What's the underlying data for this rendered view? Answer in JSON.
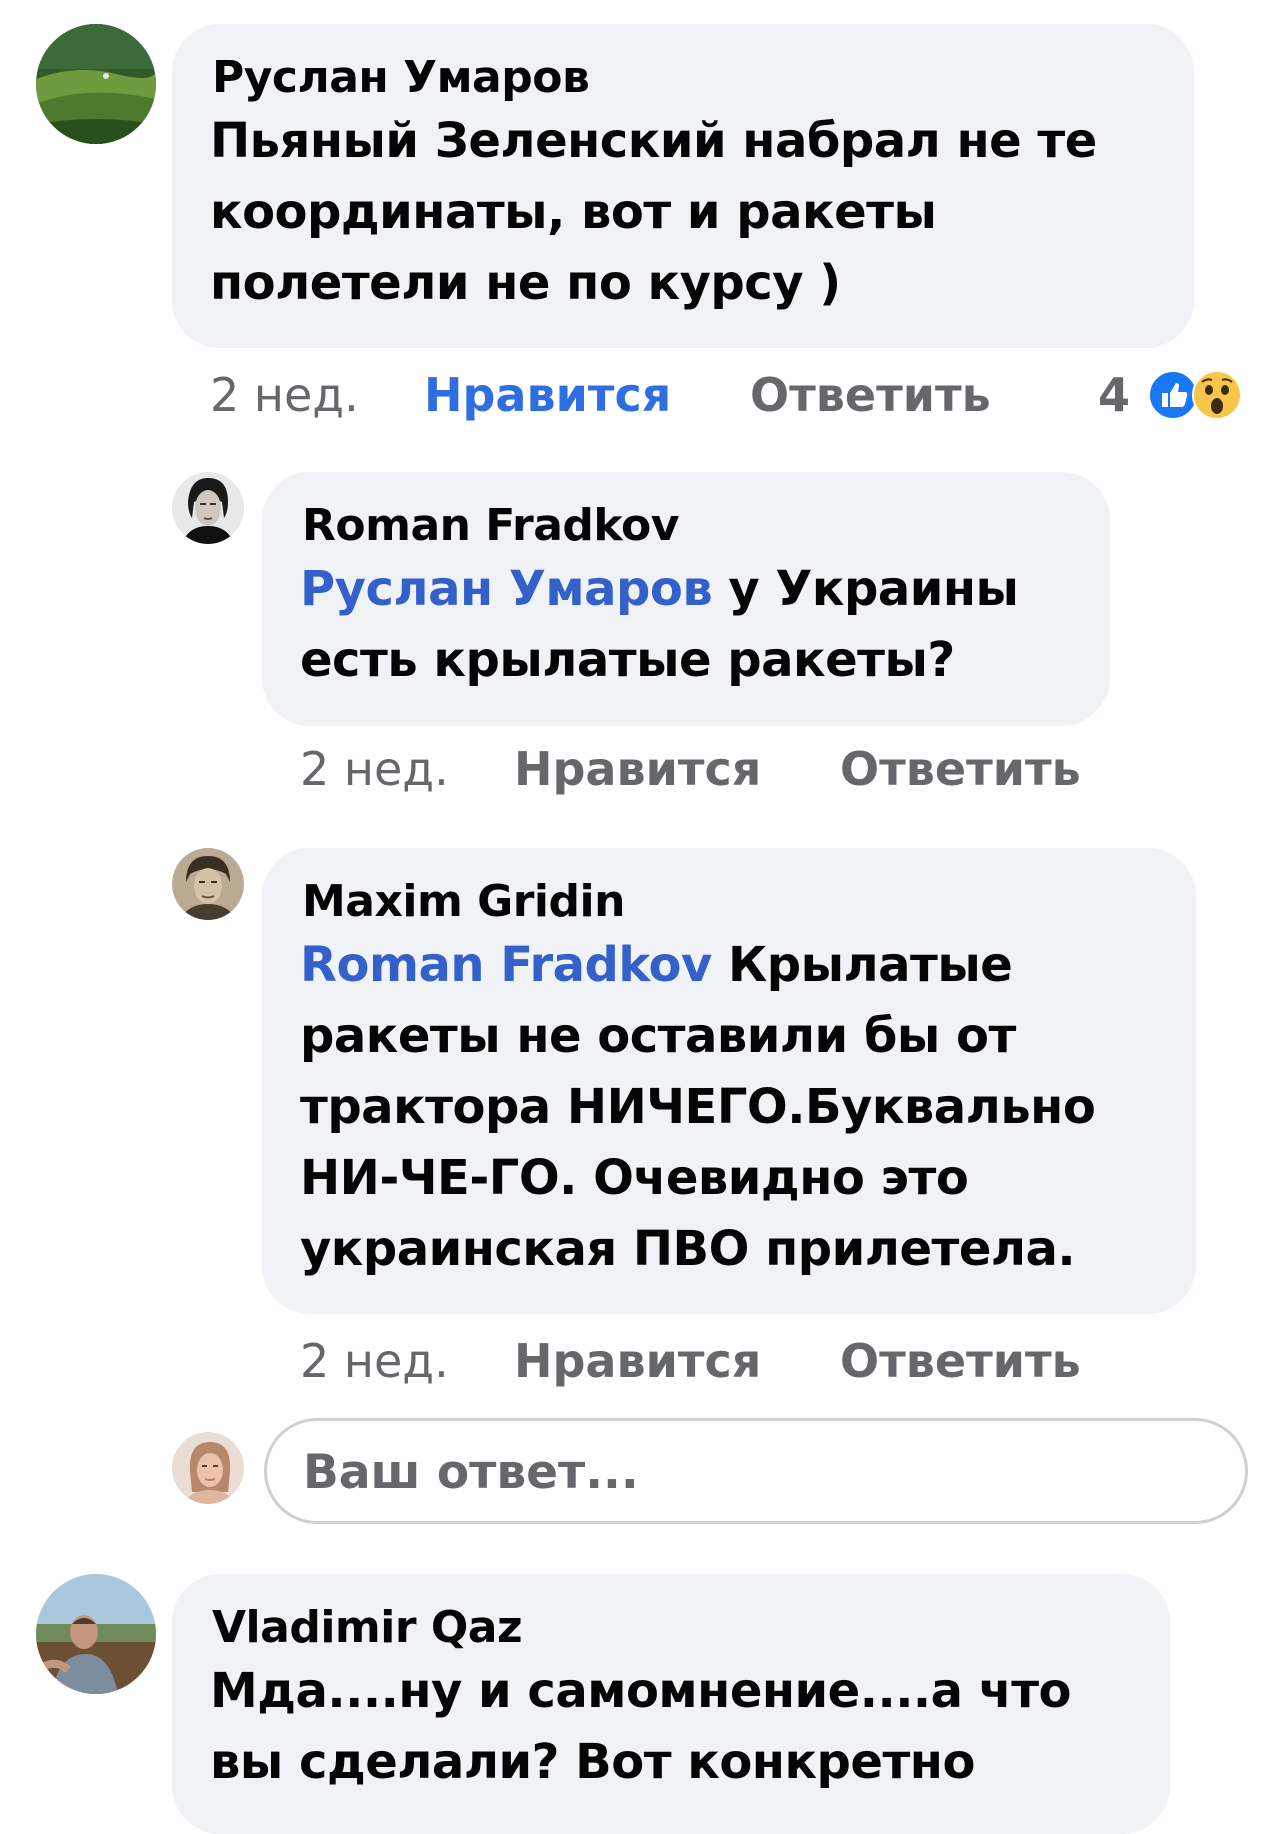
{
  "comments": [
    {
      "author": "Руслан Умаров",
      "lines": [
        "Пьяный Зеленский набрал не те",
        "координаты,  вот и ракеты",
        "полетели не по курсу )"
      ],
      "time": "2 нед.",
      "like_label": "Нравится",
      "reply_label": "Ответить",
      "reaction_count": "4",
      "reaction_icons": [
        "like-reaction-icon",
        "wow-reaction-icon"
      ]
    },
    {
      "author": "Roman Fradkov",
      "mention": "Руслан Умаров",
      "line1_rest": " у Украины",
      "lines": [
        "есть крылатые ракеты?"
      ],
      "time": "2 нед.",
      "like_label": "Нравится",
      "reply_label": "Ответить"
    },
    {
      "author": "Maxim Gridin",
      "mention": "Roman Fradkov",
      "line1_rest": " Крылатые",
      "lines": [
        "ракеты не оставили бы от",
        "трактора НИЧЕГО.Буквально",
        "НИ-ЧЕ-ГО. Очевидно это",
        "украинская ПВО прилетела."
      ],
      "time": "2 нед.",
      "like_label": "Нравится",
      "reply_label": "Ответить"
    },
    {
      "author": "Vladimir  Qaz",
      "lines": [
        "Мда....ну и самомнение....а что",
        "вы сделали? Вот конкретно"
      ]
    }
  ],
  "reply_input": {
    "placeholder": "Ваш ответ..."
  },
  "colors": {
    "bubble": "#f0f2f5",
    "mention": "#3461c9",
    "liked": "#2f6ee0",
    "meta": "#65676b"
  }
}
